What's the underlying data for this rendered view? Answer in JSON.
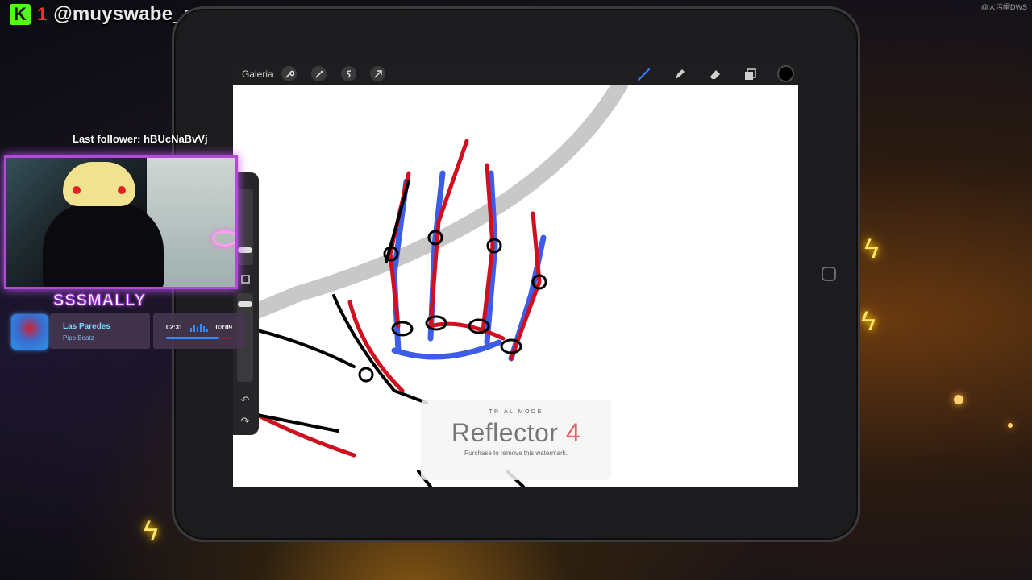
{
  "overlay": {
    "handle": "@muyswabe_store",
    "kick_logo": "K",
    "kick_badge": "1",
    "corner_tag": "@大污帽DWS",
    "last_follower": "Last follower: hBUcNaBvVj",
    "streamer_name": "SSSMALLY"
  },
  "now_playing": {
    "title": "Las Paredes",
    "artist": "Pipo Beatz",
    "current_time": "02:31",
    "duration": "03:09",
    "progress": 0.8,
    "colors": {
      "accent": "#2f8bff",
      "title": "#7fd7ff"
    }
  },
  "procreate": {
    "gallery_label": "Galeria",
    "left_tools": [
      "wrench-icon",
      "magic-wand-icon",
      "selection-icon",
      "transform-arrow-icon"
    ],
    "right_tools": [
      "brush-icon",
      "smudge-icon",
      "eraser-icon",
      "layers-icon"
    ],
    "current_color": "#000000",
    "sidebar": [
      "brush-size-slider",
      "modify-button",
      "opacity-slider",
      "undo-icon",
      "redo-icon"
    ]
  },
  "watermark": {
    "mode": "TRIAL MODE",
    "title_word": "Reflector",
    "title_number": "4",
    "subtitle": "Purchase to remove this watermark."
  },
  "colors": {
    "webcam_border": "#b14ad8",
    "kick_green": "#53fc18",
    "sketch_red": "#d0101e",
    "sketch_blue": "#3d5ce8"
  }
}
